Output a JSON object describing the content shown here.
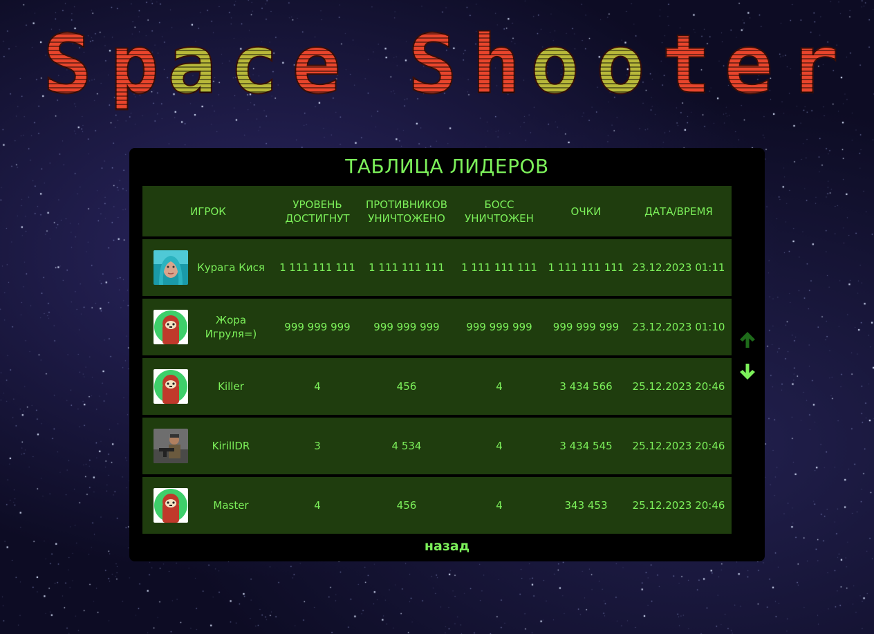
{
  "game_title": "Space Shooter",
  "leaderboard": {
    "title": "ТАБЛИЦА ЛИДЕРОВ",
    "columns": {
      "player": "ИГРОК",
      "level": "УРОВЕНЬ ДОСТИГНУТ",
      "enemies": "ПРОТИВНИКОВ УНИЧТОЖЕНО",
      "boss": "БОСС УНИЧТОЖЕН",
      "score": "ОЧКИ",
      "datetime": "ДАТА/ВРЕМЯ"
    },
    "rows": [
      {
        "avatar": "girl-photo",
        "name": "Курага Кися",
        "level": "1 111 111 111",
        "enemies": "1 111 111 111",
        "boss": "1 111 111 111",
        "score": "1 111 111 111",
        "datetime": "23.12.2023 01:11"
      },
      {
        "avatar": "sloth-icon",
        "name": "Жора Игруля=)",
        "level": "999 999 999",
        "enemies": "999 999 999",
        "boss": "999 999 999",
        "score": "999 999 999",
        "datetime": "23.12.2023 01:10"
      },
      {
        "avatar": "sloth-icon",
        "name": "Killer",
        "level": "4",
        "enemies": "456",
        "boss": "4",
        "score": "3 434 566",
        "datetime": "25.12.2023 20:46"
      },
      {
        "avatar": "soldier-photo",
        "name": "KirillDR",
        "level": "3",
        "enemies": "4 534",
        "boss": "4",
        "score": "3 434 545",
        "datetime": "25.12.2023 20:46"
      },
      {
        "avatar": "sloth-icon",
        "name": "Master",
        "level": "4",
        "enemies": "456",
        "boss": "4",
        "score": "343 453",
        "datetime": "25.12.2023 20:46"
      }
    ],
    "scroll_up_icon": "arrow-up-icon",
    "scroll_down_icon": "arrow-down-icon",
    "back_label": "назад"
  },
  "colors": {
    "text_green": "#7cf05a",
    "row_bg": "#1f3d0e",
    "panel_bg": "#000000",
    "logo_red": "#e8452c",
    "logo_yellow": "#b8b83a"
  }
}
